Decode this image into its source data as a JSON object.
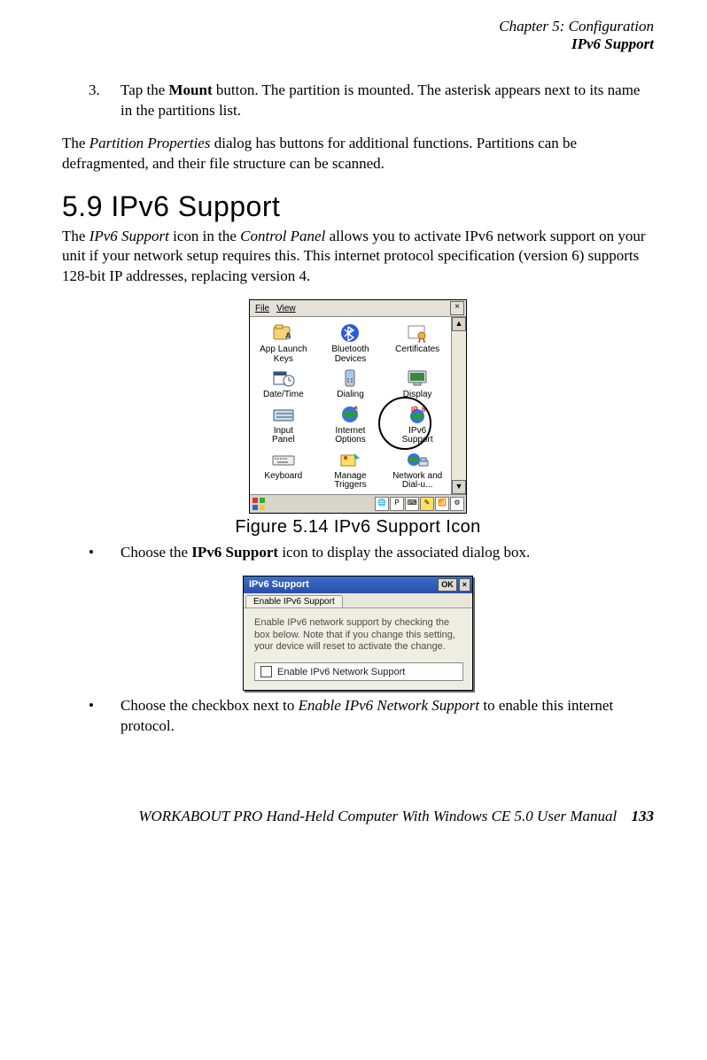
{
  "header": {
    "line1": "Chapter 5: Configuration",
    "line2": "IPv6 Support"
  },
  "step3": {
    "num": "3.",
    "pre": "Tap the ",
    "bold": "Mount",
    "post": " button. The partition is mounted. The asterisk appears next to its name in the partitions list."
  },
  "para1": {
    "pre": "The ",
    "ital": "Partition Properties",
    "post": " dialog has buttons for additional functions. Partitions can be defragmented, and their file structure can be scanned."
  },
  "heading": "5.9  IPv6 Support",
  "para2": {
    "pre": "The ",
    "ital1": "IPv6 Support",
    "mid": " icon in the ",
    "ital2": "Control Panel",
    "post": " allows you to activate IPv6 network support on your unit if your network setup requires this. This internet protocol specification (version 6) supports 128-bit IP addresses, replacing version 4."
  },
  "control_panel": {
    "menu_file": "File",
    "menu_view": "View",
    "items": [
      {
        "label": "App Launch Keys",
        "icon": "app-launch-keys-icon"
      },
      {
        "label": "Bluetooth Devices",
        "icon": "bluetooth-icon"
      },
      {
        "label": "Certificates",
        "icon": "certificates-icon"
      },
      {
        "label": "Date/Time",
        "icon": "date-time-icon"
      },
      {
        "label": "Dialing",
        "icon": "dialing-icon"
      },
      {
        "label": "Display",
        "icon": "display-icon"
      },
      {
        "label": "Input Panel",
        "icon": "input-panel-icon"
      },
      {
        "label": "Internet Options",
        "icon": "internet-options-icon"
      },
      {
        "label": "IPv6 Support",
        "icon": "ipv6-support-icon",
        "circled": true
      },
      {
        "label": "Keyboard",
        "icon": "keyboard-icon"
      },
      {
        "label": "Manage Triggers",
        "icon": "manage-triggers-icon"
      },
      {
        "label": "Network and Dial-u...",
        "icon": "network-dialup-icon"
      }
    ]
  },
  "figure_caption": "Figure 5.14 IPv6 Support Icon",
  "bullet1": {
    "pre": "Choose the ",
    "bold": "IPv6 Support",
    "post": " icon to display the associated dialog box."
  },
  "dialog": {
    "title": "IPv6 Support",
    "ok": "OK",
    "close": "×",
    "tab": "Enable IPv6 Support",
    "body": "Enable IPv6 network support by checking the box below.  Note that if you change this setting, your device will reset to activate the change.",
    "checkbox": "Enable IPv6 Network Support"
  },
  "bullet2": {
    "pre": "Choose the checkbox next to ",
    "ital": "Enable IPv6 Network Support",
    "post": " to enable this internet protocol."
  },
  "footer": {
    "text": "WORKABOUT PRO Hand-Held Computer With Windows CE 5.0 User Manual",
    "page": "133"
  }
}
